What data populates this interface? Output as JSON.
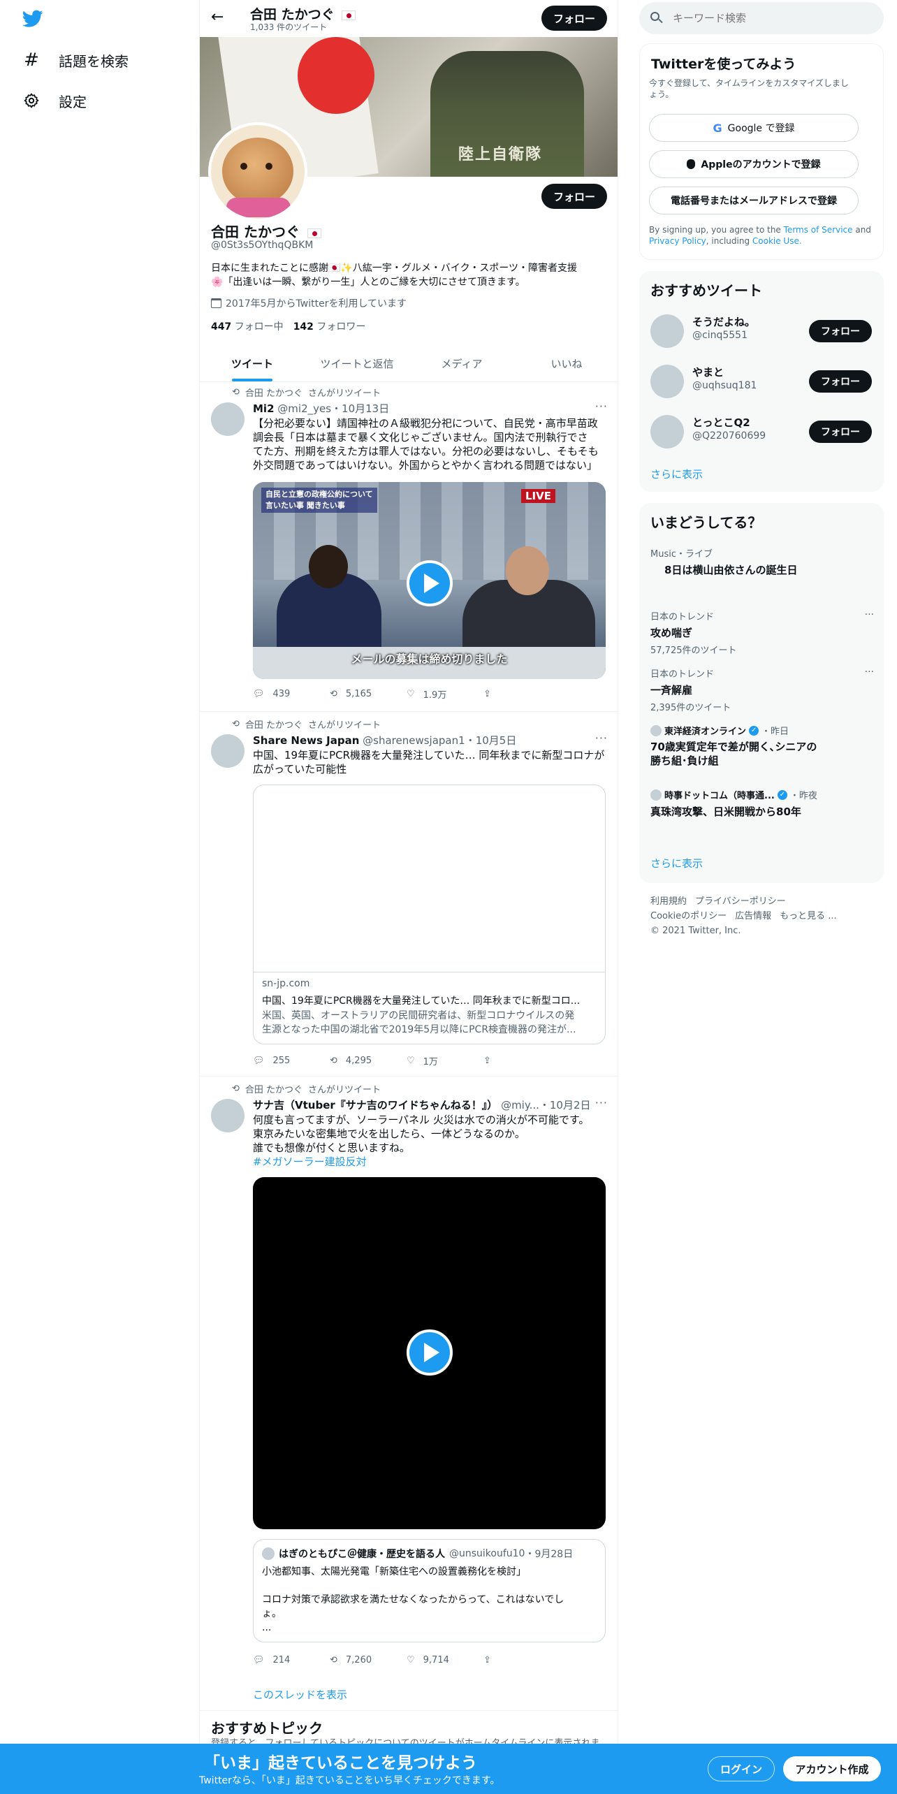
{
  "nav": {
    "explore_label": "話題を検索",
    "settings_label": "設定"
  },
  "header": {
    "name": "合田 たかつぐ",
    "tweet_count": "1,033 件のツイート",
    "follow_label": "フォロー"
  },
  "profile": {
    "name": "合田 たかつぐ",
    "handle": "@0St3s5OYthqQBKM",
    "bio_line1": "日本に生まれたことに感謝🇯🇵✨八紘一宇・グルメ・バイク・スポーツ・障害者支援",
    "bio_line2": "🌸「出逢いは一瞬、繋がり一生」人とのご縁を大切にさせて頂きます。",
    "joined": "2017年5月からTwitterを利用しています",
    "following_count": "447",
    "following_label": "フォロー中",
    "followers_count": "142",
    "followers_label": "フォロワー",
    "follow_label": "フォロー",
    "banner_text": "陸上自衛隊"
  },
  "tabs": [
    "ツイート",
    "ツイートと返信",
    "メディア",
    "いいね"
  ],
  "tweets": [
    {
      "retweet_by": "合田 たかつぐ",
      "retweet_suffix": "さんがリツイート",
      "author": "Mi2",
      "handle": "@mi2_yes",
      "date": "・10月13日",
      "line1": "【分祀必要ない】靖国神社のＡ級戦犯分祀について、自民党・高市早苗政",
      "line2": "調会長「日本は墓まで暴く文化じゃございません。国内法で刑執行でさ",
      "line3": "てた方、刑期を終えた方は罪人ではない。分祀の必要はないし、そもそも",
      "line4": "外交問題であってはいけない。外国からとやかく言われる問題ではない」",
      "video_caption": "メールの募集は締め切りました",
      "video_banner_l1": "自民と立憲の政権公約について",
      "video_banner_l2": "言いたい事 聞きたい事",
      "video_live": "LIVE",
      "replies": "439",
      "retweets": "5,165",
      "likes": "1.9万"
    },
    {
      "retweet_by": "合田 たかつぐ",
      "retweet_suffix": "さんがリツイート",
      "author": "Share News Japan",
      "handle": "@sharenewsjapan1",
      "date": "・10月5日",
      "line1": "中国、19年夏にPCR機器を大量発注していた… 同年秋までに新型コロナが",
      "line2": "広がっていた可能性",
      "card_domain": "sn-jp.com",
      "card_title": "中国、19年夏にPCR機器を大量発注していた… 同年秋までに新型コロ...",
      "card_desc1": "米国、英国、オーストラリアの民間研究者は、新型コロナウイルスの発",
      "card_desc2": "生源となった中国の湖北省で2019年5月以降にPCR検査機器の発注が...",
      "replies": "255",
      "retweets": "4,295",
      "likes": "1万"
    },
    {
      "retweet_by": "合田 たかつぐ",
      "retweet_suffix": "さんがリツイート",
      "author": "サナ吉（Vtuber『サナ吉のワイドちゃんねる！』）",
      "handle": "@miy...",
      "date": "・10月2日",
      "line1": "何度も言ってますが、ソーラーパネル 火災は水での消火が不可能です。",
      "line2": "東京みたいな密集地で火を出したら、一体どうなるのか。",
      "line3": "誰でも想像が付くと思いますね。",
      "hashtag": "#メガソーラー建設反対",
      "quote_author": "はぎのともぴこ＠健康・歴史を語る人",
      "quote_handle": "@unsuikoufu10",
      "quote_date": "・9月28日",
      "quote_line1": "小池都知事、太陽光発電「新築住宅への設置義務化を検討」",
      "quote_line2": "コロナ対策で承認欲求を満たせなくなったからって、これはないでし",
      "quote_line3": "ょ。",
      "quote_line4": "...",
      "replies": "214",
      "retweets": "7,260",
      "likes": "9,714",
      "show_thread": "このスレッドを表示"
    }
  ],
  "topics": {
    "title": "おすすめトピック",
    "subtitle": "登録すると、フォローしているトピックについてのツイートがホームタイムラインに表示されま"
  },
  "search": {
    "placeholder": "キーワード検索"
  },
  "signup": {
    "title": "Twitterを使ってみよう",
    "subtitle_l1": "今すぐ登録して、タイムラインをカスタマイズしまし",
    "subtitle_l2": "ょう。",
    "google": "Google で登録",
    "apple": "Appleのアカウントで登録",
    "phone": "電話番号またはメールアドレスで登録",
    "legal_l1a": "By signing up, you agree to the ",
    "legal_tos": "Terms of Service",
    "legal_and": " and",
    "legal_privacy": "Privacy Policy",
    "legal_incl": ", including ",
    "legal_cookie": "Cookie Use."
  },
  "who_to_follow": {
    "title": "おすすめツイート",
    "users": [
      {
        "name": "そうだよね。",
        "handle": "@cinq5551"
      },
      {
        "name": "やまと",
        "handle": "@uqhsuq181"
      },
      {
        "name": "とっとこQ2",
        "handle": "@Q220760699"
      }
    ],
    "follow_label": "フォロー",
    "show_more": "さらに表示"
  },
  "trends": {
    "title": "いまどうしてる？",
    "items": [
      {
        "category": "Music・ライブ",
        "name": "8日は横山由依さんの誕生日"
      },
      {
        "category": "日本のトレンド",
        "name": "攻め喘ぎ",
        "count": "57,725件のツイート"
      },
      {
        "category": "日本のトレンド",
        "name": "一斉解雇",
        "count": "2,395件のツイート"
      }
    ],
    "news": [
      {
        "source": "東洋経済オンライン",
        "time": "・昨日",
        "title_l1": "70歳実質定年で差が開く､シニアの",
        "title_l2": "勝ち組･負け組"
      },
      {
        "source": "時事ドットコム（時事通...",
        "time": "・昨夜",
        "title_l1": "真珠湾攻撃、日米開戦から80年"
      }
    ],
    "show_more": "さらに表示"
  },
  "footer": {
    "terms": "利用規約",
    "privacy": "プライバシーポリシー",
    "cookie": "Cookieのポリシー",
    "ads": "広告情報",
    "more": "もっと見る ...",
    "copyright": "© 2021 Twitter, Inc."
  },
  "bottom": {
    "headline": "「いま」起きていることを見つけよう",
    "sub": "Twitterなら、「いま」起きていることをいち早くチェックできます。",
    "login": "ログイン",
    "signup": "アカウント作成"
  },
  "colors": {
    "brand": "#1d9bf0",
    "text": "#0f1419",
    "muted": "#536471"
  }
}
